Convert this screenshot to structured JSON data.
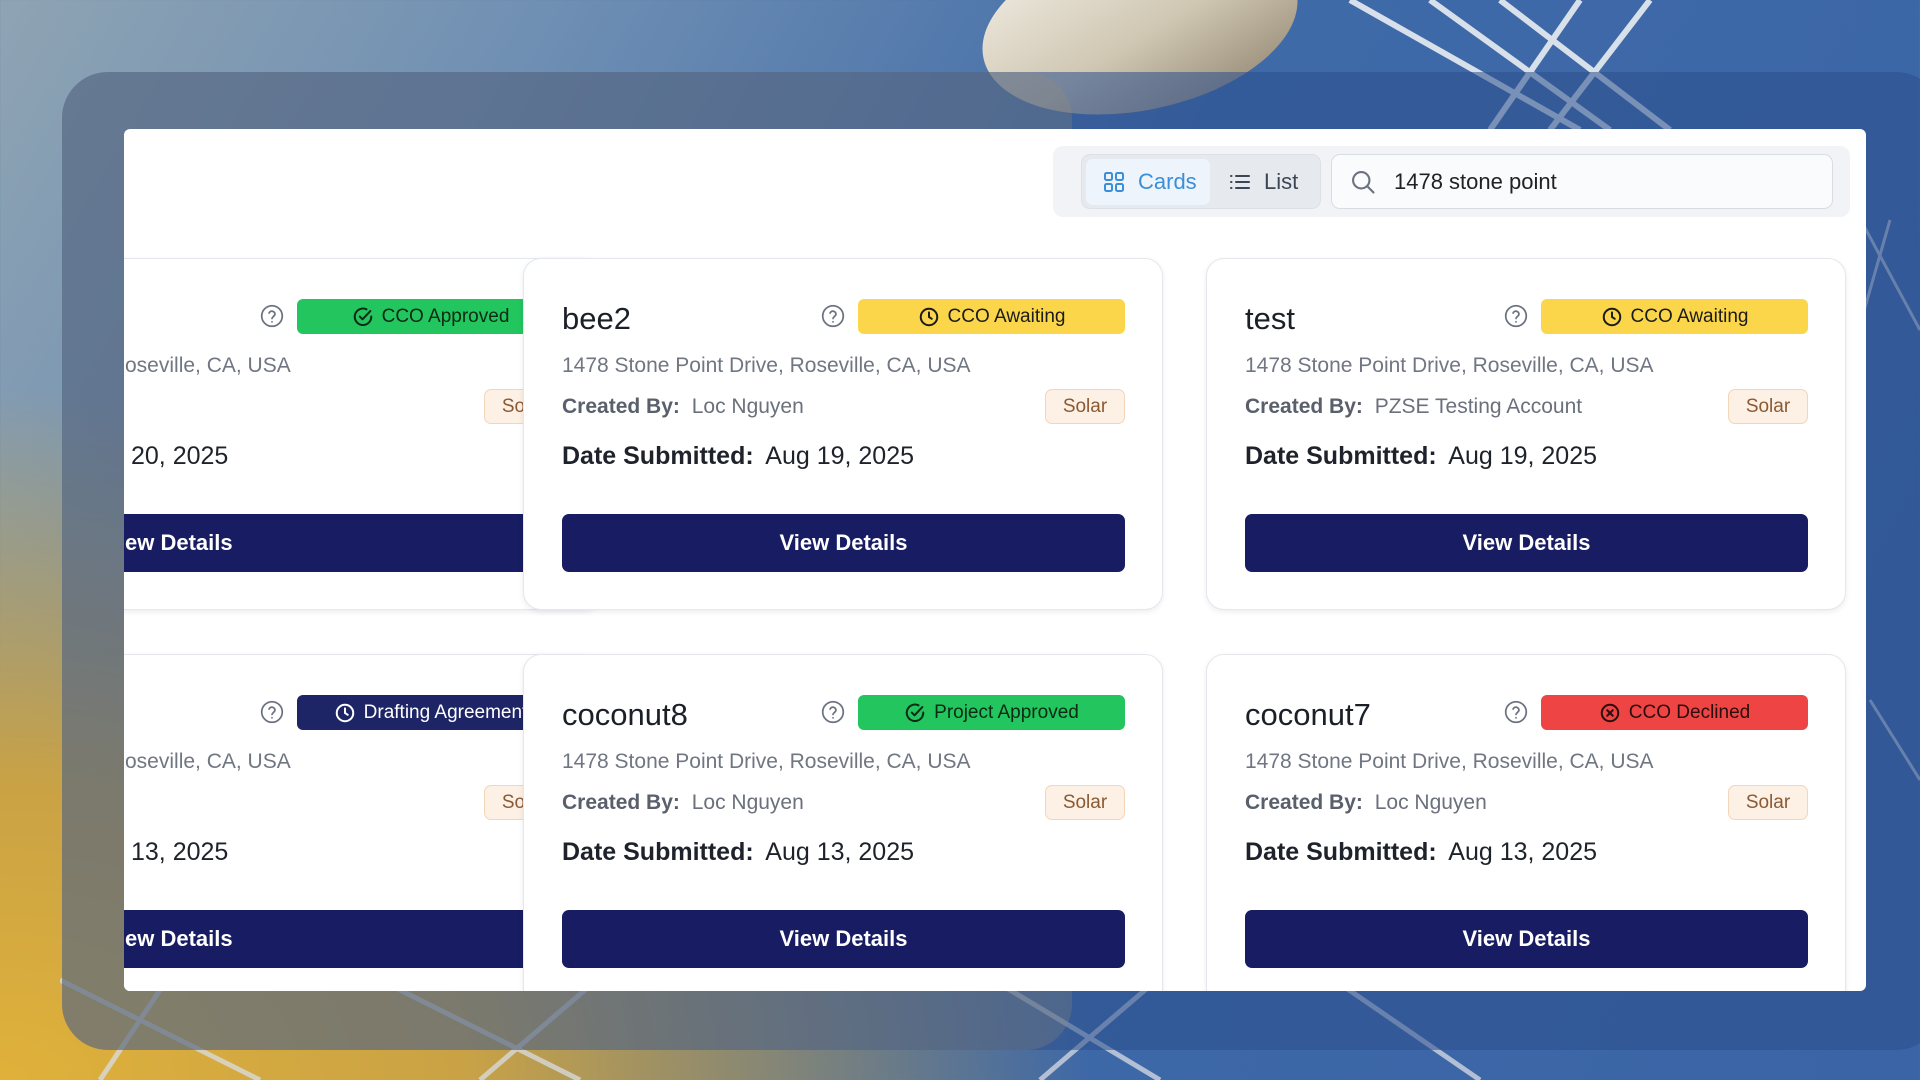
{
  "toolbar": {
    "view_cards_label": "Cards",
    "view_list_label": "List",
    "active_view": "Cards",
    "search_value": "1478 stone point"
  },
  "colors": {
    "primary_button": "#171c63",
    "cco_approved": "#22c55e",
    "cco_awaiting": "#fcd64a",
    "drafting_agreement": "#1e2566",
    "project_approved": "#22c55e",
    "cco_declined": "#ef4444",
    "type_badge_bg": "#fdf0e4"
  },
  "cards": [
    {
      "name": "",
      "status": "CCO Approved",
      "status_icon": "check-circle-icon",
      "address": "oseville, CA, USA",
      "created_by_label": "",
      "created_by": "",
      "type": "Solar",
      "date_label": "",
      "date": "20, 2025",
      "button": "ew Details"
    },
    {
      "name": "bee2",
      "status": "CCO Awaiting",
      "status_icon": "clock-icon",
      "address": "1478 Stone Point Drive, Roseville, CA, USA",
      "created_by_label": "Created By:",
      "created_by": "Loc Nguyen",
      "type": "Solar",
      "date_label": "Date Submitted:",
      "date": "Aug 19, 2025",
      "button": "View Details"
    },
    {
      "name": "test",
      "status": "CCO Awaiting",
      "status_icon": "clock-icon",
      "address": "1478 Stone Point Drive, Roseville, CA, USA",
      "created_by_label": "Created By:",
      "created_by": "PZSE Testing Account",
      "type": "Solar",
      "date_label": "Date Submitted:",
      "date": "Aug 19, 2025",
      "button": "View Details"
    },
    {
      "name": "",
      "status": "Drafting Agreement",
      "status_icon": "clock-icon",
      "address": "oseville, CA, USA",
      "created_by_label": "",
      "created_by": "",
      "type": "Solar",
      "date_label": "",
      "date": "13, 2025",
      "button": "ew Details"
    },
    {
      "name": "coconut8",
      "status": "Project Approved",
      "status_icon": "check-circle-icon",
      "address": "1478 Stone Point Drive, Roseville, CA, USA",
      "created_by_label": "Created By:",
      "created_by": "Loc Nguyen",
      "type": "Solar",
      "date_label": "Date Submitted:",
      "date": "Aug 13, 2025",
      "button": "View Details"
    },
    {
      "name": "coconut7",
      "status": "CCO Declined",
      "status_icon": "x-circle-icon",
      "address": "1478 Stone Point Drive, Roseville, CA, USA",
      "created_by_label": "Created By:",
      "created_by": "Loc Nguyen",
      "type": "Solar",
      "date_label": "Date Submitted:",
      "date": "Aug 13, 2025",
      "button": "View Details"
    }
  ]
}
